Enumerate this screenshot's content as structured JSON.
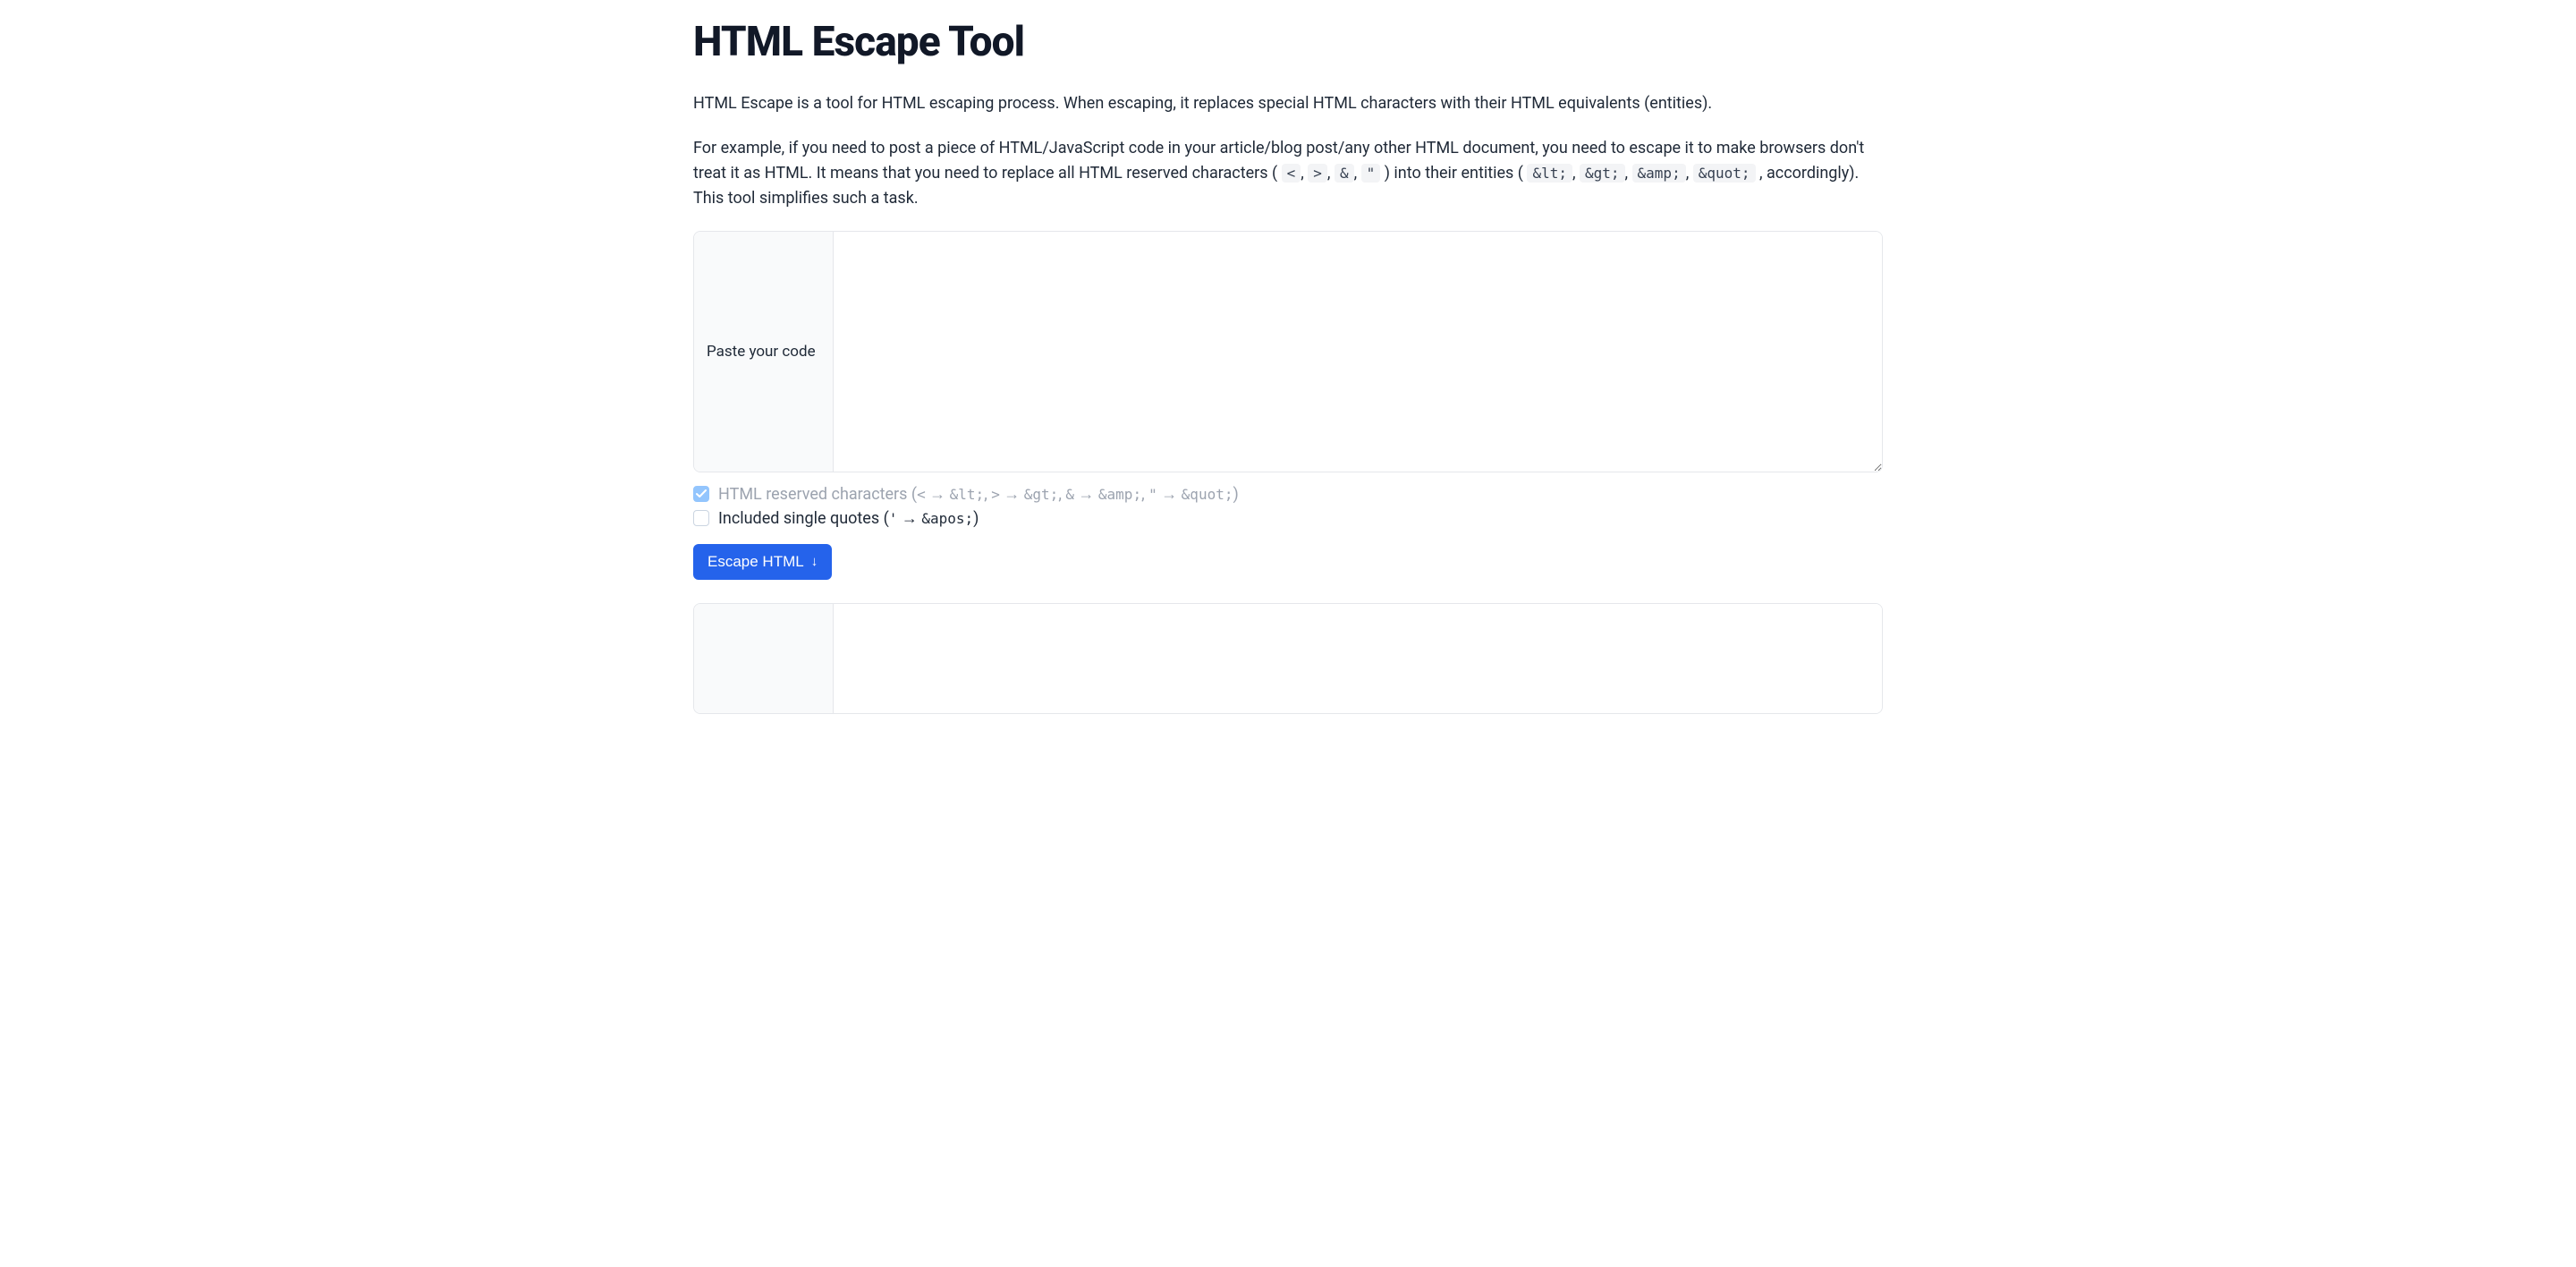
{
  "title": "HTML Escape Tool",
  "intro": "HTML Escape is a tool for HTML escaping process. When escaping, it replaces special HTML characters with their HTML equivalents (entities).",
  "example": {
    "pre": "For example, if you need to post a piece of HTML/JavaScript code in your article/blog post/any other HTML document, you need to escape it to make browsers don't treat it as HTML. It means that you need to replace all HTML reserved characters (",
    "c1": "<",
    "sep": ", ",
    "c2": ">",
    "c3": "&",
    "c4": "\"",
    "mid": ") into their entities (",
    "e1": "&lt;",
    "e2": "&gt;",
    "e3": "&amp;",
    "e4": "&quot;",
    "post": ", accordingly). This tool simplifies such a task."
  },
  "input": {
    "label": "Paste your code",
    "value": "",
    "placeholder": ""
  },
  "options": {
    "reserved": {
      "checked": true,
      "disabled": true,
      "pre": "HTML reserved characters (",
      "m1_from": "<",
      "m1_to": "&lt;",
      "m2_from": ">",
      "m2_to": "&gt;",
      "m3_from": "&",
      "m3_to": "&amp;",
      "m4_from": "\"",
      "m4_to": "&quot;",
      "post": ")"
    },
    "single": {
      "checked": false,
      "pre": "Included single quotes (",
      "from": "'",
      "to": "&apos;",
      "post": ")"
    }
  },
  "button": {
    "label": "Escape HTML",
    "arrow": "↓"
  },
  "output": {
    "label": "",
    "value": ""
  }
}
